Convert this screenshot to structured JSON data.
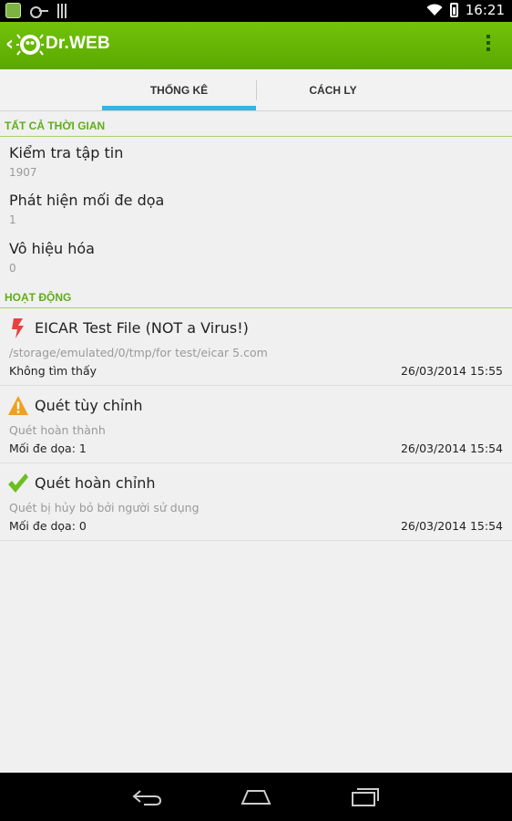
{
  "status_bar": {
    "time": "16:21",
    "icons": [
      "android-notification-icon",
      "key-icon",
      "signal-bars-icon",
      "wifi-icon",
      "battery-icon"
    ]
  },
  "action_bar": {
    "title": "Dr.WEB",
    "back_icon": "back-chevron-icon",
    "logo_icon": "drweb-spider-logo",
    "overflow_icon": "overflow-menu-icon",
    "color": "#66b800"
  },
  "tabs": [
    {
      "label": "THỐNG KÊ",
      "selected": true
    },
    {
      "label": "CÁCH LY",
      "selected": false
    }
  ],
  "sections": {
    "all_time": {
      "header": "TẤT CẢ THỜI GIAN",
      "stats": [
        {
          "label": "Kiểm tra tập tin",
          "value": "1907"
        },
        {
          "label": "Phát hiện mối đe dọa",
          "value": "1"
        },
        {
          "label": "Vô hiệu hóa",
          "value": "0"
        }
      ]
    },
    "activity": {
      "header": "HOẠT ĐỘNG",
      "items": [
        {
          "icon": "lightning-icon",
          "icon_color": "#e8413e",
          "title": "EICAR Test File (NOT a Virus!)",
          "subtitle": "/storage/emulated/0/tmp/for test/eicar 5.com",
          "status": "Không tìm thấy",
          "date": "26/03/2014 15:55"
        },
        {
          "icon": "warning-icon",
          "icon_color": "#f0a020",
          "title": "Quét tùy chỉnh",
          "subtitle": "Quét hoàn thành",
          "status": "Mối đe dọa: 1",
          "date": "26/03/2014 15:54"
        },
        {
          "icon": "checkmark-icon",
          "icon_color": "#6cbf1e",
          "title": "Quét hoàn chỉnh",
          "subtitle": "Quét bị hủy bỏ bởi người sử dụng",
          "status": "Mối đe dọa: 0",
          "date": "26/03/2014 15:54"
        }
      ]
    }
  },
  "nav_bar": {
    "buttons": [
      "back-icon",
      "home-icon",
      "recent-apps-icon"
    ]
  }
}
